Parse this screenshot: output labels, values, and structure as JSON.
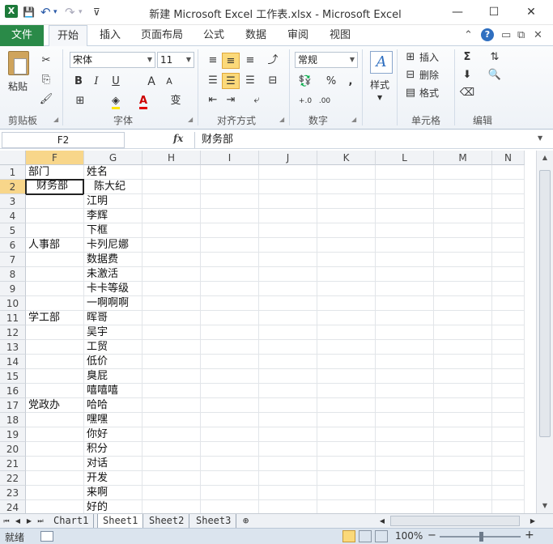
{
  "titlebar": {
    "title": "新建 Microsoft Excel 工作表.xlsx  -  Microsoft Excel",
    "logo": "X",
    "save_icon": "💾",
    "undo_icon": "↶",
    "undo_dropdown": "▾",
    "redo_icon": "↷",
    "redo_dropdown": "▾",
    "customize_qa": "⊽",
    "minimize": "—",
    "maximize": "☐",
    "close": "✕"
  },
  "ribbon_tabs": [
    "文件",
    "开始",
    "插入",
    "页面布局",
    "公式",
    "数据",
    "审阅",
    "视图"
  ],
  "ribbon_tools": {
    "collapse": "⌃",
    "help": "?",
    "win_min": "▭",
    "win_restore": "⧉",
    "win_close": "✕"
  },
  "ribbon": {
    "clipboard": {
      "paste": "粘贴",
      "label": "剪贴板"
    },
    "font": {
      "name": "宋体",
      "size": "11",
      "bold": "B",
      "italic": "I",
      "underline": "U",
      "grow": "A",
      "shrink": "A",
      "wen": "变",
      "label": "字体"
    },
    "alignment": {
      "label": "对齐方式"
    },
    "number": {
      "format": "常规",
      "percent": "%",
      "comma": ",",
      "label": "数字"
    },
    "styles": {
      "label": "样式"
    },
    "cells": {
      "insert": "插入",
      "delete": "删除",
      "format": "格式",
      "label": "单元格"
    },
    "editing": {
      "sum": "Σ",
      "label": "编辑"
    }
  },
  "formula_bar": {
    "name_box": "F2",
    "fx": "fx",
    "content": "财务部"
  },
  "columns": [
    "F",
    "G",
    "H",
    "I",
    "J",
    "K",
    "L",
    "M",
    "N"
  ],
  "active_column": "F",
  "active_row": "2",
  "rows": [
    {
      "num": "1",
      "F": "部门",
      "G": "姓名"
    },
    {
      "num": "2",
      "F": "财务部",
      "G": "陈大纪"
    },
    {
      "num": "3",
      "F": "",
      "G": "江明"
    },
    {
      "num": "4",
      "F": "",
      "G": "李辉"
    },
    {
      "num": "5",
      "F": "",
      "G": "下框"
    },
    {
      "num": "6",
      "F": "人事部",
      "G": "卡列尼娜"
    },
    {
      "num": "7",
      "F": "",
      "G": "数据费"
    },
    {
      "num": "8",
      "F": "",
      "G": "未激活"
    },
    {
      "num": "9",
      "F": "",
      "G": "卡卡等级"
    },
    {
      "num": "10",
      "F": "",
      "G": "一啊啊啊"
    },
    {
      "num": "11",
      "F": "学工部",
      "G": "晖哥"
    },
    {
      "num": "12",
      "F": "",
      "G": "吴宇"
    },
    {
      "num": "13",
      "F": "",
      "G": "工贸"
    },
    {
      "num": "14",
      "F": "",
      "G": "低价"
    },
    {
      "num": "15",
      "F": "",
      "G": "臭屁"
    },
    {
      "num": "16",
      "F": "",
      "G": "嘻嘻嘻"
    },
    {
      "num": "17",
      "F": "党政办",
      "G": "哈哈"
    },
    {
      "num": "18",
      "F": "",
      "G": "嘿嘿"
    },
    {
      "num": "19",
      "F": "",
      "G": "你好"
    },
    {
      "num": "20",
      "F": "",
      "G": "积分"
    },
    {
      "num": "21",
      "F": "",
      "G": "对话"
    },
    {
      "num": "22",
      "F": "",
      "G": "开发"
    },
    {
      "num": "23",
      "F": "",
      "G": "来啊"
    },
    {
      "num": "24",
      "F": "",
      "G": "好的"
    }
  ],
  "sheets": [
    "Chart1",
    "Sheet1",
    "Sheet2",
    "Sheet3"
  ],
  "active_sheet": "Sheet1",
  "status": {
    "ready": "就绪",
    "zoom": "100%",
    "zoom_out": "−",
    "zoom_in": "+"
  },
  "colors": {
    "file_tab": "#2a8a48",
    "active_header": "#f8d68a",
    "selected_button": "#fbd97a"
  }
}
